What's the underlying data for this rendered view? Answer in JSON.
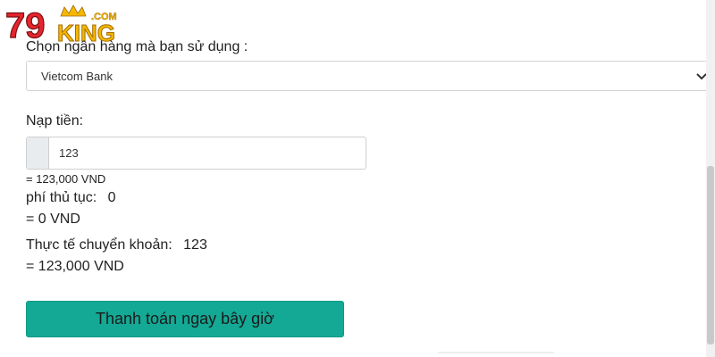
{
  "logo": {
    "number": "79",
    "word": "KING",
    "tld": ".COM"
  },
  "bank": {
    "label": "Chọn ngân hàng mà bạn sử dụng :",
    "selected": "Vietcom Bank"
  },
  "deposit": {
    "label": "Nạp tiền:",
    "amount": "123",
    "converted": "= 123,000 VND"
  },
  "fee": {
    "label": "phí thủ tục:",
    "value": "0",
    "converted": "= 0 VND"
  },
  "actual": {
    "label": "Thực tế chuyển khoản:",
    "value": "123",
    "converted": "= 123,000 VND"
  },
  "pay_button": "Thanh toán ngay bây giờ",
  "colors": {
    "accent": "#13a995",
    "logo_red": "#e3262d",
    "logo_gold": "#f5b800"
  }
}
